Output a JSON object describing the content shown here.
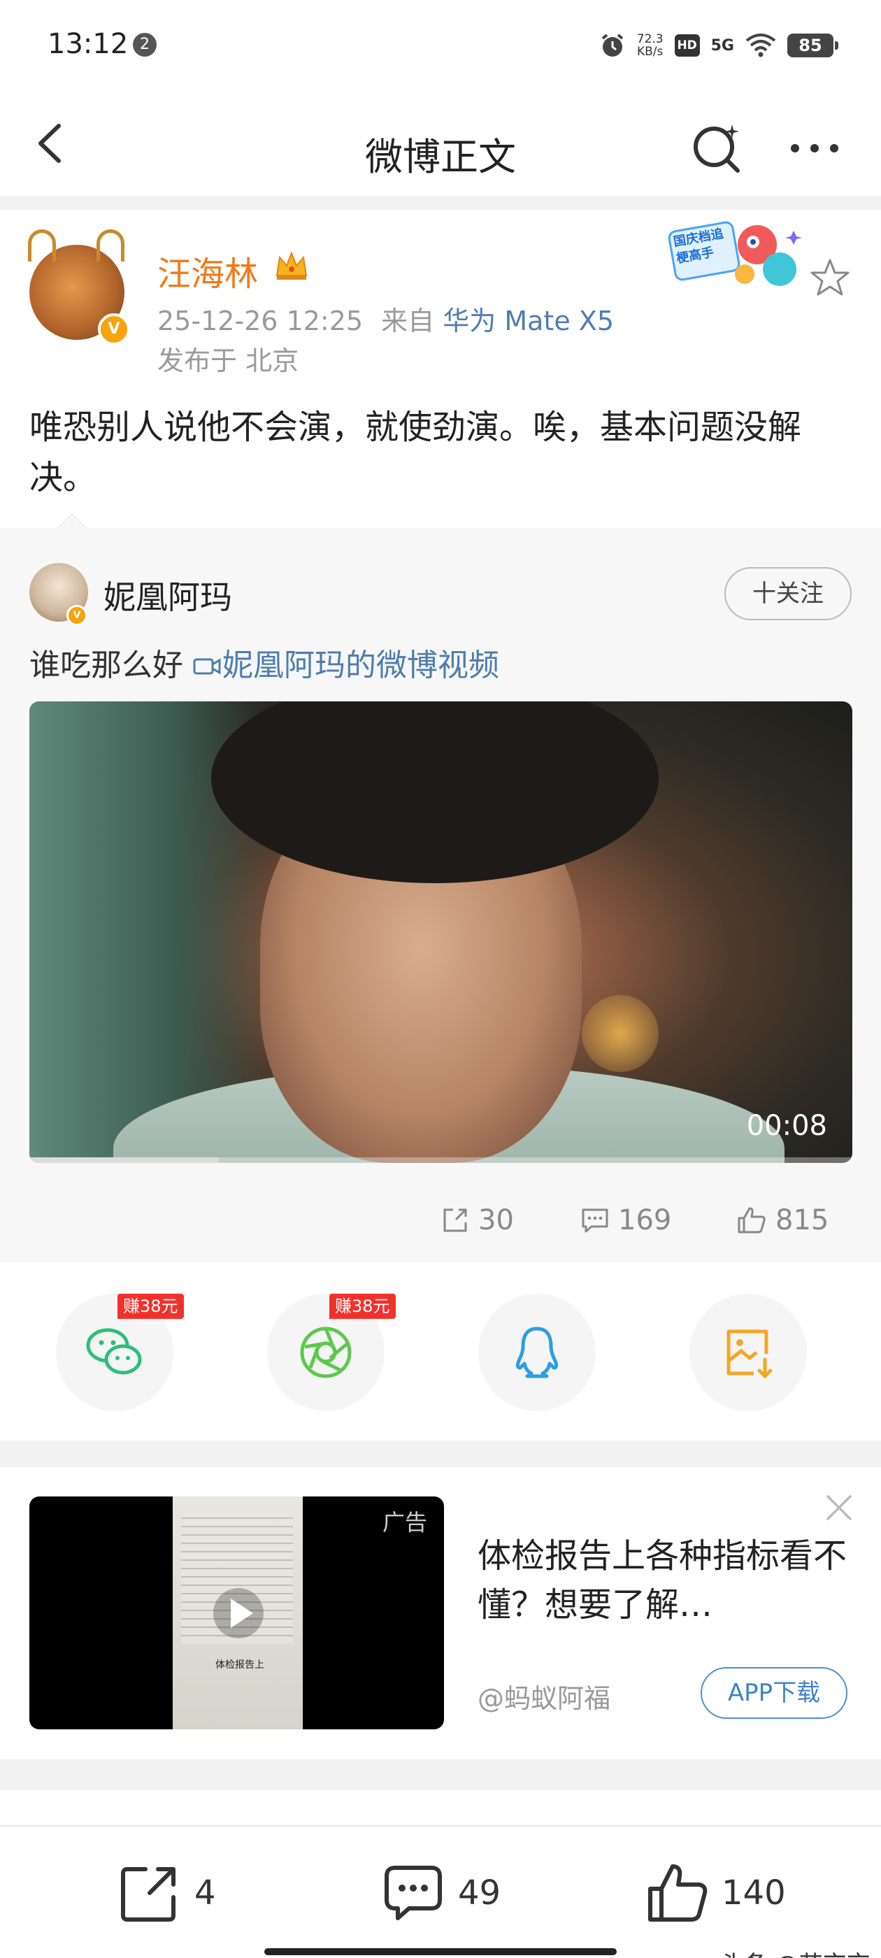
{
  "status_bar": {
    "time": "13:12",
    "notification_count": "2",
    "net_speed_value": "72.3",
    "net_speed_unit": "KB/s",
    "hd_label": "HD",
    "network_label": "5G",
    "battery": "85"
  },
  "nav": {
    "title": "微博正文"
  },
  "post": {
    "author": "汪海林",
    "time": "25-12-26 12:25",
    "from_label": "来自",
    "device": "华为 Mate X5",
    "location": "发布于 北京",
    "text": "唯恐别人说他不会演，就使劲演。唉，基本问题没解决。",
    "promo_text": "国庆档追梗高手",
    "verify_mark": "V"
  },
  "repost": {
    "author": "妮凰阿玛",
    "follow_label": "十关注",
    "text": "谁吃那么好 ",
    "video_link": "妮凰阿玛的微博视频",
    "video_duration": "00:08",
    "video_progress": 0.23,
    "reposts": "30",
    "comments": "169",
    "likes": "815"
  },
  "share": {
    "earn_label": "赚38元",
    "colors": {
      "wechat": "#2bbf7a",
      "moments": "#5cc94c",
      "qq": "#2d9ee0",
      "save": "#f5a623"
    }
  },
  "ad": {
    "label": "广告",
    "title": "体检报告上各种指标看不懂？想要了解…",
    "thumb_caption": "体检报告上",
    "source": "@蚂蚁阿福",
    "button": "APP下载"
  },
  "bottom": {
    "reposts": "4",
    "comments": "49",
    "likes": "140"
  },
  "watermark": "头条 @苗京京"
}
